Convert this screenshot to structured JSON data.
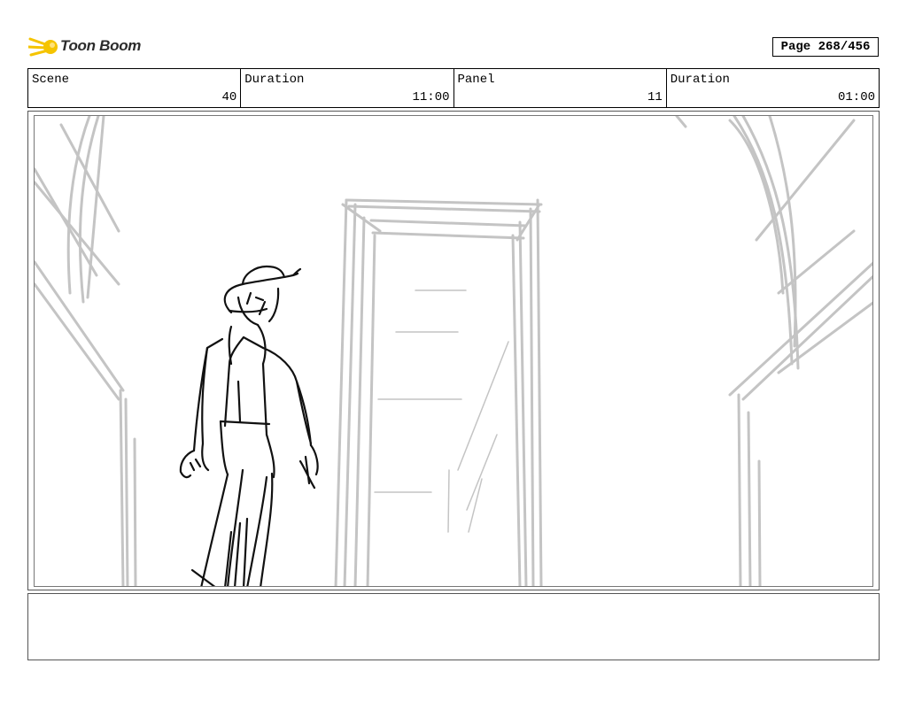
{
  "brand": {
    "name": "Toon Boom",
    "icon": "toon-boom-comet-icon",
    "accent": "#f5c400"
  },
  "page_indicator": "Page 268/456",
  "header": {
    "scene_label": "Scene",
    "scene_value": "40",
    "scene_duration_label": "Duration",
    "scene_duration_value": "11:00",
    "panel_label": "Panel",
    "panel_value": "11",
    "panel_duration_label": "Duration",
    "panel_duration_value": "01:00"
  },
  "sketch": {
    "background_stroke_color": "#c4c4c4",
    "character_stroke_color": "#111111"
  },
  "notes": ""
}
